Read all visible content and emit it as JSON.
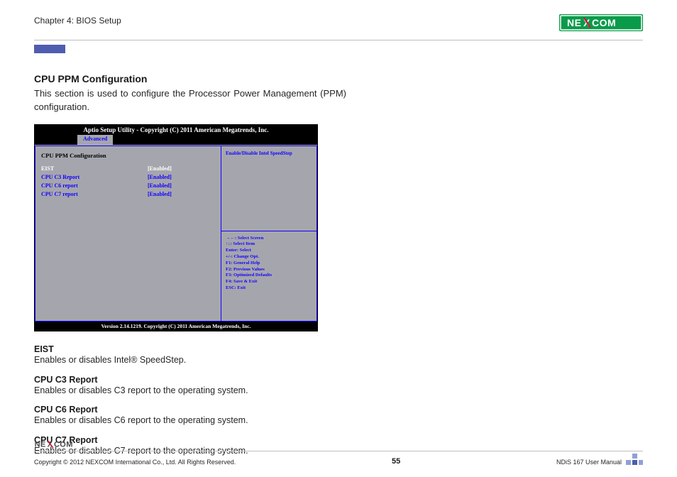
{
  "header": {
    "chapter": "Chapter 4: BIOS Setup",
    "brand": "NEXCOM"
  },
  "section": {
    "title": "CPU PPM Configuration",
    "intro": "This section is used to configure the Processor Power Management (PPM) configuration."
  },
  "bios": {
    "title": "Aptio Setup Utility - Copyright (C) 2011 American Megatrends, Inc.",
    "tab": "Advanced",
    "cfg_head": "CPU PPM Configuration",
    "rows": [
      {
        "label": "EIST",
        "value": "[Enabled]",
        "selected": true
      },
      {
        "label": "CPU C3 Report",
        "value": "[Enabled]",
        "selected": false
      },
      {
        "label": "CPU C6 report",
        "value": "[Enabled]",
        "selected": false
      },
      {
        "label": "CPU C7 report",
        "value": "[Enabled]",
        "selected": false
      }
    ],
    "help": "Enable/Disable Intel SpeedStep",
    "keys": [
      "→←: Select Screen",
      "↑↓: Select Item",
      "Enter: Select",
      "+/-: Change Opt.",
      "F1: General Help",
      "F2: Previous Values",
      "F3: Optimized Defaults",
      "F4: Save & Exit",
      "ESC: Exit"
    ],
    "version": "Version 2.14.1219. Copyright (C) 2011 American Megatrends, Inc."
  },
  "descriptions": [
    {
      "label": "EIST",
      "text": "Enables or disables Intel® SpeedStep."
    },
    {
      "label": "CPU C3 Report",
      "text": "Enables or disables C3 report to the operating system."
    },
    {
      "label": "CPU C6 Report",
      "text": "Enables or disables C6 report to the operating system."
    },
    {
      "label": "CPU C7 Report",
      "text": "Enables or disables C7 report to the operating system."
    }
  ],
  "footer": {
    "copyright": "Copyright © 2012 NEXCOM International Co., Ltd. All Rights Reserved.",
    "page": "55",
    "manual": "NDiS 167 User Manual"
  },
  "colors": {
    "brand_green": "#0a9b4a",
    "bios_blue": "#1400ff",
    "bios_grey": "#a5a6ad",
    "accent_indigo": "#4e5db0"
  }
}
